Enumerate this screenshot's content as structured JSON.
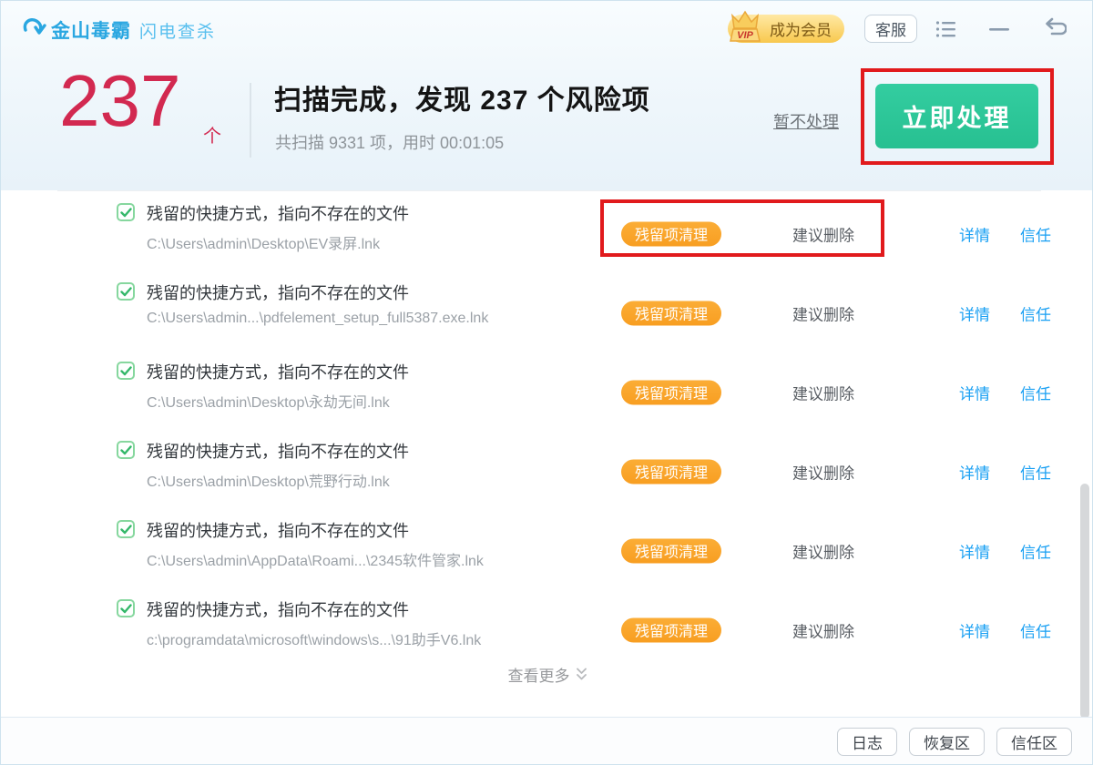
{
  "topbar": {
    "brand": "金山毒霸",
    "brand_sub": "闪电查杀",
    "vip_text": "VIP",
    "vip_label": "成为会员",
    "support_label": "客服"
  },
  "header": {
    "count": "237",
    "unit": "个",
    "title": "扫描完成，发现 237 个风险项",
    "summary": "共扫描 9331 项，用时 00:01:05",
    "skip_label": "暂不处理",
    "process_label": "立即处理"
  },
  "list": {
    "rows": [
      {
        "title": "残留的快捷方式，指向不存在的文件",
        "path": "C:\\Users\\admin\\Desktop\\EV录屏.lnk",
        "badge": "残留项清理",
        "advice": "建议删除",
        "detail_label": "详情",
        "trust_label": "信任",
        "annotated": true
      },
      {
        "title": "残留的快捷方式，指向不存在的文件",
        "path": "C:\\Users\\admin...\\pdfelement_setup_full5387.exe.lnk",
        "badge": "残留项清理",
        "advice": "建议删除",
        "detail_label": "详情",
        "trust_label": "信任",
        "annotated": false
      },
      {
        "title": "残留的快捷方式，指向不存在的文件",
        "path": "C:\\Users\\admin\\Desktop\\永劫无间.lnk",
        "badge": "残留项清理",
        "advice": "建议删除",
        "detail_label": "详情",
        "trust_label": "信任",
        "annotated": false
      },
      {
        "title": "残留的快捷方式，指向不存在的文件",
        "path": "C:\\Users\\admin\\Desktop\\荒野行动.lnk",
        "badge": "残留项清理",
        "advice": "建议删除",
        "detail_label": "详情",
        "trust_label": "信任",
        "annotated": false
      },
      {
        "title": "残留的快捷方式，指向不存在的文件",
        "path": "C:\\Users\\admin\\AppData\\Roami...\\2345软件管家.lnk",
        "badge": "残留项清理",
        "advice": "建议删除",
        "detail_label": "详情",
        "trust_label": "信任",
        "annotated": false
      },
      {
        "title": "残留的快捷方式，指向不存在的文件",
        "path": "c:\\programdata\\microsoft\\windows\\s...\\91助手V6.lnk",
        "badge": "残留项清理",
        "advice": "建议删除",
        "detail_label": "详情",
        "trust_label": "信任",
        "annotated": false
      }
    ],
    "more_label": "查看更多"
  },
  "footer": {
    "log_label": "日志",
    "recovery_label": "恢复区",
    "trustzone_label": "信任区"
  },
  "colors": {
    "accent_blue": "#2aa7e1",
    "danger_red": "#d22950",
    "action_green": "#2cc797",
    "badge_orange": "#f9a42c",
    "link_blue": "#1aa0f3",
    "annotation_red": "#e11a1c"
  }
}
